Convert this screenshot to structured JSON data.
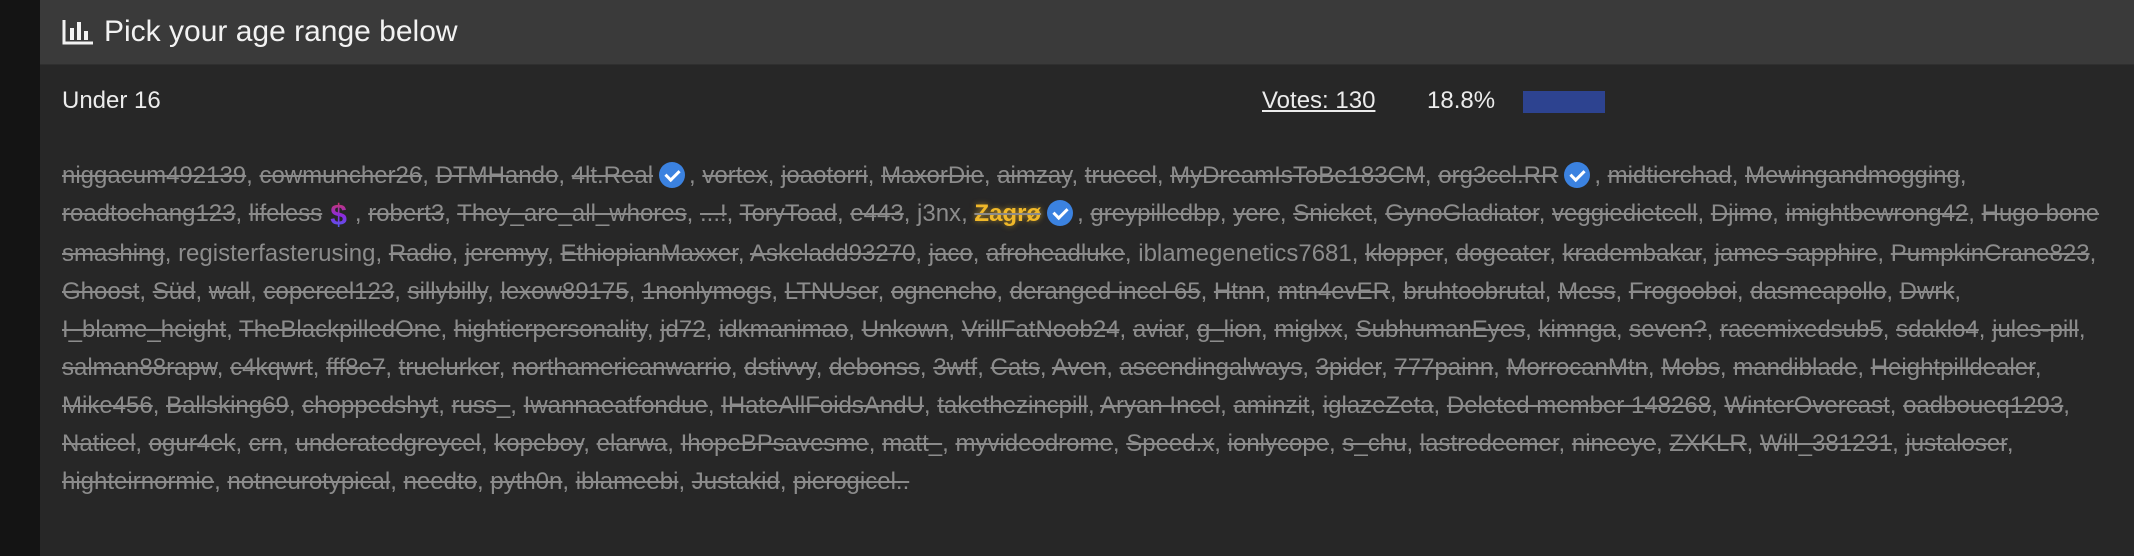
{
  "poll": {
    "title": "Pick your age range below",
    "option": {
      "label": "Under 16",
      "votes": "Votes: 130",
      "percent": "18.8%",
      "fraction": 0.188
    },
    "colors": {
      "bar": "#2d4390",
      "badge": "#3b82e0",
      "gold": "#f0b829"
    },
    "voters": [
      {
        "name": "niggacum492139",
        "struck": true
      },
      {
        "name": "cowmuncher26",
        "struck": true
      },
      {
        "name": "DTMHando",
        "struck": true
      },
      {
        "name": "4lt.Real",
        "struck": true,
        "badge": "verified"
      },
      {
        "name": "vortex",
        "struck": true
      },
      {
        "name": "joaotorri",
        "struck": true
      },
      {
        "name": "MaxorDie",
        "struck": true
      },
      {
        "name": "aimzay",
        "struck": true
      },
      {
        "name": "truecel",
        "struck": true
      },
      {
        "name": "MyDreamIsToBe183CM",
        "struck": true
      },
      {
        "name": "org3cel.RR",
        "struck": true,
        "badge": "verified"
      },
      {
        "name": "midtierchad",
        "struck": true
      },
      {
        "name": "Mewingandmogging",
        "struck": true
      },
      {
        "name": "roadtochang123",
        "struck": true
      },
      {
        "name": "lifeless",
        "struck": true,
        "badge": "dollar"
      },
      {
        "name": "robert3",
        "struck": true
      },
      {
        "name": "They_are_all_whores",
        "struck": true
      },
      {
        "name": "...!",
        "struck": true
      },
      {
        "name": "ToryToad",
        "struck": true
      },
      {
        "name": "e443",
        "struck": true
      },
      {
        "name": "j3nx",
        "struck": false
      },
      {
        "name": "Zagrø",
        "struck": true,
        "gold": true,
        "badge": "verified"
      },
      {
        "name": "greypilledbp",
        "struck": true
      },
      {
        "name": "yere",
        "struck": true
      },
      {
        "name": "Snicket",
        "struck": true
      },
      {
        "name": "GynoGladiator",
        "struck": true
      },
      {
        "name": "veggiedietcell",
        "struck": true
      },
      {
        "name": "Djimo",
        "struck": true
      },
      {
        "name": "imightbewrong42",
        "struck": true
      },
      {
        "name": "Hugo bone smashing",
        "struck": true
      },
      {
        "name": "registerfasterusing",
        "struck": false
      },
      {
        "name": "Radio",
        "struck": true
      },
      {
        "name": "jeremyy",
        "struck": true
      },
      {
        "name": "EthiopianMaxxer",
        "struck": true
      },
      {
        "name": "Askeladd93270",
        "struck": true
      },
      {
        "name": "jaco",
        "struck": true
      },
      {
        "name": "afroheadluke",
        "struck": true
      },
      {
        "name": "iblamegenetics7681",
        "struck": false
      },
      {
        "name": "klopper",
        "struck": true
      },
      {
        "name": "dogeater",
        "struck": true
      },
      {
        "name": "kradembakar",
        "struck": true
      },
      {
        "name": "james sapphire",
        "struck": true
      },
      {
        "name": "PumpkinCrane823",
        "struck": true
      },
      {
        "name": "Ghoost",
        "struck": true
      },
      {
        "name": "Süd",
        "struck": true
      },
      {
        "name": "wall",
        "struck": true
      },
      {
        "name": "copercel123",
        "struck": true
      },
      {
        "name": "sillybilly",
        "struck": true
      },
      {
        "name": "lexow89175",
        "struck": true
      },
      {
        "name": "1nonlymogs",
        "struck": true
      },
      {
        "name": "LTNUser",
        "struck": true
      },
      {
        "name": "ognencho",
        "struck": true
      },
      {
        "name": "deranged incel 65",
        "struck": true
      },
      {
        "name": "Htnn",
        "struck": true
      },
      {
        "name": "mtn4evER",
        "struck": true
      },
      {
        "name": "bruhtoobrutal",
        "struck": true
      },
      {
        "name": "Mess",
        "struck": true
      },
      {
        "name": "Frogooboi",
        "struck": true
      },
      {
        "name": "dasmeapollo",
        "struck": true
      },
      {
        "name": "Dwrk",
        "struck": true
      },
      {
        "name": "I_blame_height",
        "struck": true
      },
      {
        "name": "TheBlackpilledOne",
        "struck": true
      },
      {
        "name": "hightierpersonality",
        "struck": true
      },
      {
        "name": "jd72",
        "struck": true
      },
      {
        "name": "idkmanimao",
        "struck": true
      },
      {
        "name": "Unkown",
        "struck": true
      },
      {
        "name": "VrillFatNoob24",
        "struck": true
      },
      {
        "name": "aviar",
        "struck": true
      },
      {
        "name": "g_lion",
        "struck": true
      },
      {
        "name": "miglxx",
        "struck": true
      },
      {
        "name": "SubhumanEyes",
        "struck": true
      },
      {
        "name": "kimnga",
        "struck": true
      },
      {
        "name": "seven?",
        "struck": true
      },
      {
        "name": "racemixedsub5",
        "struck": true
      },
      {
        "name": "sdaklo4",
        "struck": true
      },
      {
        "name": "jules-pill",
        "struck": true
      },
      {
        "name": "salman88rapw",
        "struck": true
      },
      {
        "name": "c4kqwrt",
        "struck": true
      },
      {
        "name": "fff8e7",
        "struck": true
      },
      {
        "name": "truelurker",
        "struck": true
      },
      {
        "name": "northamericanwarrio",
        "struck": true
      },
      {
        "name": "dstivvy",
        "struck": true
      },
      {
        "name": "debonss",
        "struck": true
      },
      {
        "name": "3wtf",
        "struck": true
      },
      {
        "name": "Cats",
        "struck": true
      },
      {
        "name": "Aven",
        "struck": true
      },
      {
        "name": "ascendingalways",
        "struck": true
      },
      {
        "name": "3pider",
        "struck": true
      },
      {
        "name": "777painn",
        "struck": true
      },
      {
        "name": "MorrocanMtn",
        "struck": true
      },
      {
        "name": "Mobs",
        "struck": true
      },
      {
        "name": "mandiblade",
        "struck": true
      },
      {
        "name": "Heightpilldealer",
        "struck": true
      },
      {
        "name": "Mike456",
        "struck": true
      },
      {
        "name": "Ballsking69",
        "struck": true
      },
      {
        "name": "choppedshyt",
        "struck": true
      },
      {
        "name": "russ_",
        "struck": true
      },
      {
        "name": "Iwannaeatfondue",
        "struck": true
      },
      {
        "name": "IHateAllFoidsAndU",
        "struck": true
      },
      {
        "name": "takethezincpill",
        "struck": true
      },
      {
        "name": "Aryan Incel",
        "struck": true
      },
      {
        "name": "aminzit",
        "struck": true
      },
      {
        "name": "iglazeZeta",
        "struck": true
      },
      {
        "name": "Deleted member 148268",
        "struck": true
      },
      {
        "name": "WinterOvercast",
        "struck": true
      },
      {
        "name": "oadboueq1293",
        "struck": true
      },
      {
        "name": "Naticel",
        "struck": true
      },
      {
        "name": "ogur4ek",
        "struck": true
      },
      {
        "name": "crn",
        "struck": true
      },
      {
        "name": "underatedgreycel",
        "struck": true
      },
      {
        "name": "kopeboy",
        "struck": true
      },
      {
        "name": "elarwa",
        "struck": true
      },
      {
        "name": "IhopeBPsavesme",
        "struck": true
      },
      {
        "name": "matt_",
        "struck": true
      },
      {
        "name": "myvideodrome",
        "struck": true
      },
      {
        "name": "Speed.x",
        "struck": true
      },
      {
        "name": "ionlycope",
        "struck": true
      },
      {
        "name": "s_chu",
        "struck": true
      },
      {
        "name": "lastredeemer",
        "struck": true
      },
      {
        "name": "nineeye",
        "struck": true
      },
      {
        "name": "ZXKLR",
        "struck": true
      },
      {
        "name": "Will_381231",
        "struck": true
      },
      {
        "name": "justaloser",
        "struck": true
      },
      {
        "name": "highteirnormie",
        "struck": true
      },
      {
        "name": "notneurotypical",
        "struck": true
      },
      {
        "name": "needto",
        "struck": true
      },
      {
        "name": "pyth0n",
        "struck": true
      },
      {
        "name": "iblameebi",
        "struck": true
      },
      {
        "name": "Justakid",
        "struck": true
      },
      {
        "name": "pierogicel..",
        "struck": true
      }
    ]
  }
}
